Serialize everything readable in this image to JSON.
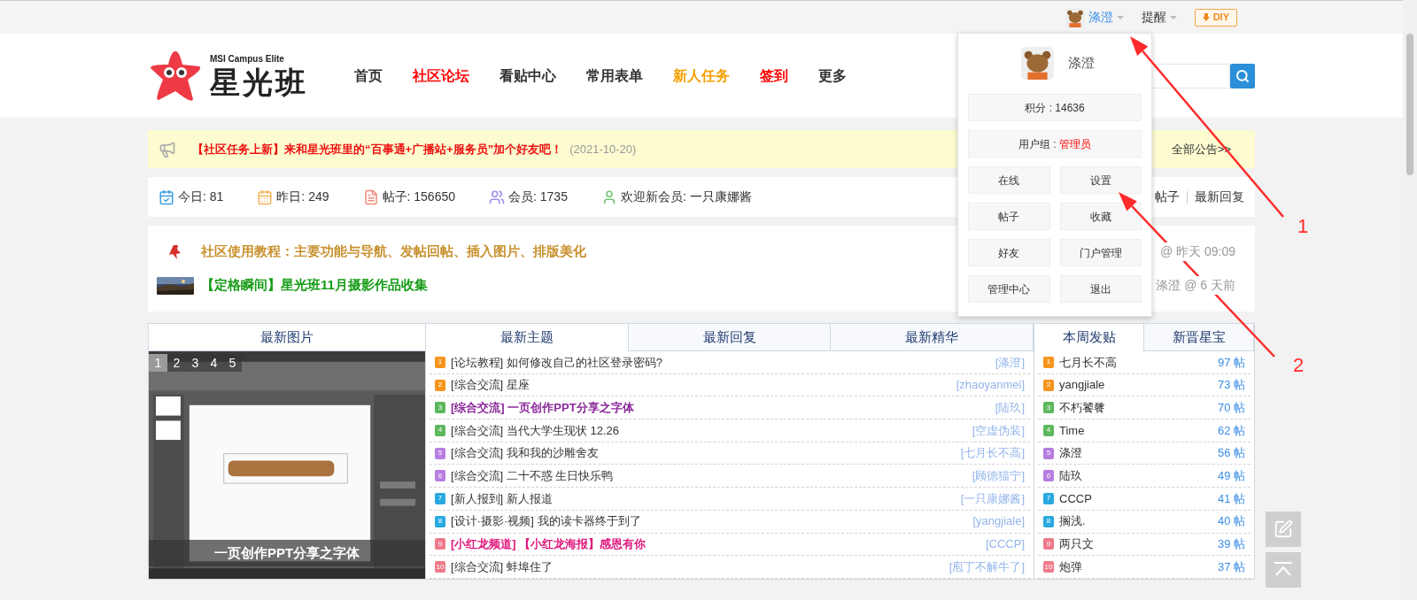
{
  "top_bar": {
    "user": {
      "name": "涤澄"
    },
    "reminder": "提醒",
    "diy_button": "DIY"
  },
  "header": {
    "logo": {
      "subtitle": "MSI Campus Elite",
      "title": "星光班"
    },
    "nav": [
      {
        "label": "首页",
        "color": "#333333"
      },
      {
        "label": "社区论坛",
        "color": "#ff0000"
      },
      {
        "label": "看贴中心",
        "color": "#333333"
      },
      {
        "label": "常用表单",
        "color": "#333333"
      },
      {
        "label": "新人任务",
        "color": "#f5a000"
      },
      {
        "label": "签到",
        "color": "#ff0000"
      },
      {
        "label": "更多",
        "color": "#333333"
      }
    ]
  },
  "notice": {
    "text": "【社区任务上新】来和星光班里的“百事通+广播站+服务员”加个好友吧！",
    "date": "(2021-10-20)",
    "more": "全部公告>>"
  },
  "stats": {
    "items": [
      {
        "kind": "today",
        "text": "今日: 81"
      },
      {
        "kind": "yesterday",
        "text": "昨日: 249"
      },
      {
        "kind": "posts",
        "text": "帖子: 156650"
      },
      {
        "kind": "members",
        "text": "会员: 1735"
      },
      {
        "kind": "newest",
        "text": "欢迎新会员: 一只康娜酱"
      }
    ],
    "links": [
      "帖子",
      "最新回复"
    ]
  },
  "sticky": [
    {
      "kind": "pin",
      "title": "社区使用教程：主要功能与导航、发帖回帖、插入图片、排版美化",
      "color": "#c8912f",
      "meta": "@ 昨天 09:09"
    },
    {
      "title": "【定格瞬间】星光班11月摄影作品收集",
      "color": "#179c17",
      "meta": "涤澄 @ 6 天前"
    }
  ],
  "image_panel": {
    "title": "最新图片",
    "pages": [
      {
        "label": "1",
        "selected": true
      },
      {
        "label": "2",
        "selected": false
      },
      {
        "label": "3",
        "selected": false
      },
      {
        "label": "4",
        "selected": false
      },
      {
        "label": "5",
        "selected": false
      }
    ],
    "caption": "一页创作PPT分享之字体"
  },
  "threads": {
    "tabs": [
      {
        "label": "最新主题",
        "selected": true
      },
      {
        "label": "最新回复",
        "selected": false
      },
      {
        "label": "最新精华",
        "selected": false
      }
    ],
    "rows": [
      {
        "badge": {
          "rank": "1",
          "color": "#f7941d"
        },
        "category": "[论坛教程]",
        "title": "如何修改自己的社区登录密码?",
        "author": "[涤澄]"
      },
      {
        "badge": {
          "rank": "2",
          "color": "#f7941d"
        },
        "category": "[综合交流]",
        "title": "星座",
        "author": "[zhaoyanmei]"
      },
      {
        "badge": {
          "rank": "3",
          "color": "#5cb85c"
        },
        "category": "[综合交流]",
        "title": "一页创作PPT分享之字体",
        "author": "[陆玖]",
        "color": "#8b2a9a"
      },
      {
        "badge": {
          "rank": "4",
          "color": "#5cb85c"
        },
        "category": "[综合交流]",
        "title": "当代大学生现状 12.26",
        "author": "[空虚伪装]"
      },
      {
        "badge": {
          "rank": "5",
          "color": "#b77de0"
        },
        "category": "[综合交流]",
        "title": "我和我的沙雕舍友",
        "author": "[七月长不高]"
      },
      {
        "badge": {
          "rank": "6",
          "color": "#b77de0"
        },
        "category": "[综合交流]",
        "title": "二十不惑 生日快乐鸭",
        "author": "[顾德猫宁]"
      },
      {
        "badge": {
          "rank": "7",
          "color": "#29a9e0"
        },
        "category": "[新人报到]",
        "title": "新人报道",
        "author": "[一只康娜酱]"
      },
      {
        "badge": {
          "rank": "8",
          "color": "#29a9e0"
        },
        "category": "[设计·摄影·视频]",
        "title": "我的读卡器终于到了",
        "author": "[yangjiale]"
      },
      {
        "badge": {
          "rank": "9",
          "color": "#ee7a8a"
        },
        "category": "[小红龙频道]",
        "title": "【小红龙海报】感恩有你",
        "author": "[CCCP]",
        "color": "#e0197d"
      },
      {
        "badge": {
          "rank": "10",
          "color": "#ee7a8a"
        },
        "category": "[综合交流]",
        "title": "蚌埠住了",
        "author": "[庖丁不解牛了]"
      }
    ]
  },
  "posters": {
    "tabs": [
      {
        "label": "本周发贴",
        "selected": true
      },
      {
        "label": "新晋星宝",
        "selected": false
      }
    ],
    "rows": [
      {
        "badge": {
          "rank": "1",
          "color": "#f7941d"
        },
        "name": "七月长不高",
        "count": "97 帖"
      },
      {
        "badge": {
          "rank": "2",
          "color": "#f7941d"
        },
        "name": "yangjiale",
        "count": "73 帖"
      },
      {
        "badge": {
          "rank": "3",
          "color": "#5cb85c"
        },
        "name": "不朽饕餮",
        "count": "70 帖"
      },
      {
        "badge": {
          "rank": "4",
          "color": "#5cb85c"
        },
        "name": "Time",
        "count": "62 帖"
      },
      {
        "badge": {
          "rank": "5",
          "color": "#b77de0"
        },
        "name": "涤澄",
        "count": "56 帖"
      },
      {
        "badge": {
          "rank": "6",
          "color": "#b77de0"
        },
        "name": "陆玖",
        "count": "49 帖"
      },
      {
        "badge": {
          "rank": "7",
          "color": "#29a9e0"
        },
        "name": "CCCP",
        "count": "41 帖"
      },
      {
        "badge": {
          "rank": "8",
          "color": "#29a9e0"
        },
        "name": "搁浅.",
        "count": "40 帖"
      },
      {
        "badge": {
          "rank": "9",
          "color": "#ee7a8a"
        },
        "name": "两只文",
        "count": "39 帖"
      },
      {
        "badge": {
          "rank": "10",
          "color": "#ee7a8a"
        },
        "name": "炮弹",
        "count": "37 帖"
      }
    ]
  },
  "user_menu": {
    "name": "涤澄",
    "points": "积分 : 14636",
    "group_label": "用户组 : ",
    "group": "管理员",
    "buttons": [
      "在线",
      "设置",
      "帖子",
      "收藏",
      "好友",
      "门户管理",
      "管理中心",
      "退出"
    ]
  },
  "annotations": [
    {
      "label": "1"
    },
    {
      "label": "2"
    }
  ]
}
